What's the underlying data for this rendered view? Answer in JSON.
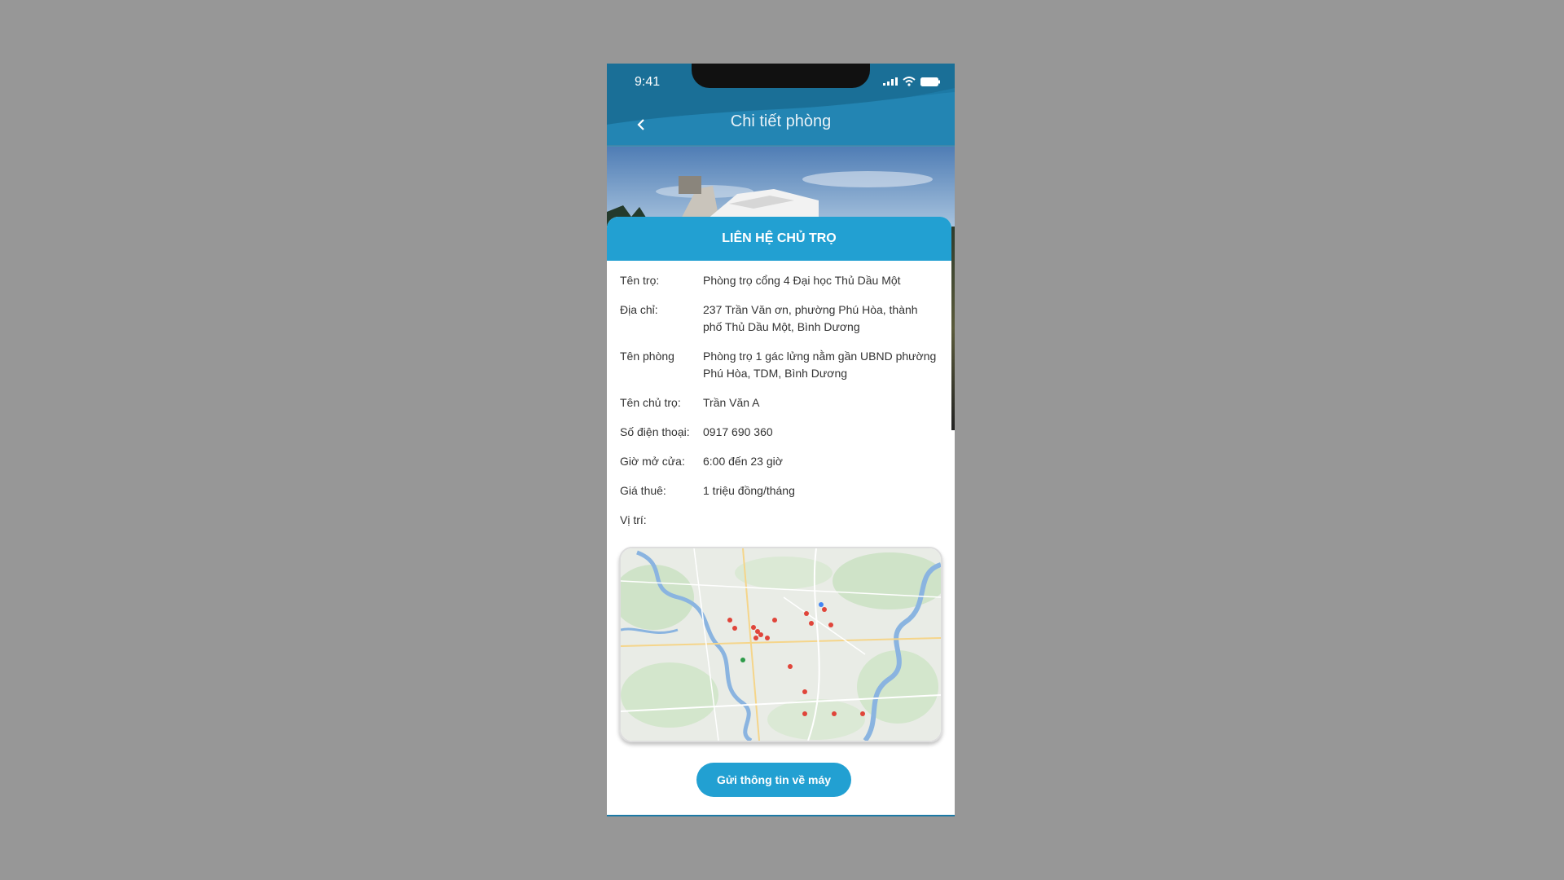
{
  "status_bar": {
    "time": "9:41"
  },
  "header": {
    "title": "Chi tiết phòng",
    "back_icon": "chevron-left-icon"
  },
  "card": {
    "title": "LIÊN HỆ CHỦ TRỌ",
    "fields": [
      {
        "label": "Tên trọ:",
        "value": "Phòng trọ cổng 4 Đại học Thủ Dầu Một"
      },
      {
        "label": "Địa chỉ:",
        "value": "237 Trần Văn ơn, phường Phú Hòa, thành phố Thủ Dầu Một, Bình Dương"
      },
      {
        "label": "Tên phòng",
        "value": "Phòng trọ  1 gác lửng nằm gần UBND phường Phú Hòa, TDM, Bình Dương"
      },
      {
        "label": "Tên chủ trọ:",
        "value": "Trần Văn A"
      },
      {
        "label": "Số điện thoại:",
        "value": "0917 690 360"
      },
      {
        "label": "Giờ mở cửa:",
        "value": "6:00 đến 23 giờ"
      },
      {
        "label": "Giá thuê:",
        "value": "1 triệu đồng/tháng"
      },
      {
        "label": "Vị trí:",
        "value": ""
      }
    ],
    "send_button": "Gửi thông tin về máy"
  },
  "colors": {
    "header": "#1d7aa6",
    "accent": "#22a0d2",
    "background": "#979797"
  }
}
